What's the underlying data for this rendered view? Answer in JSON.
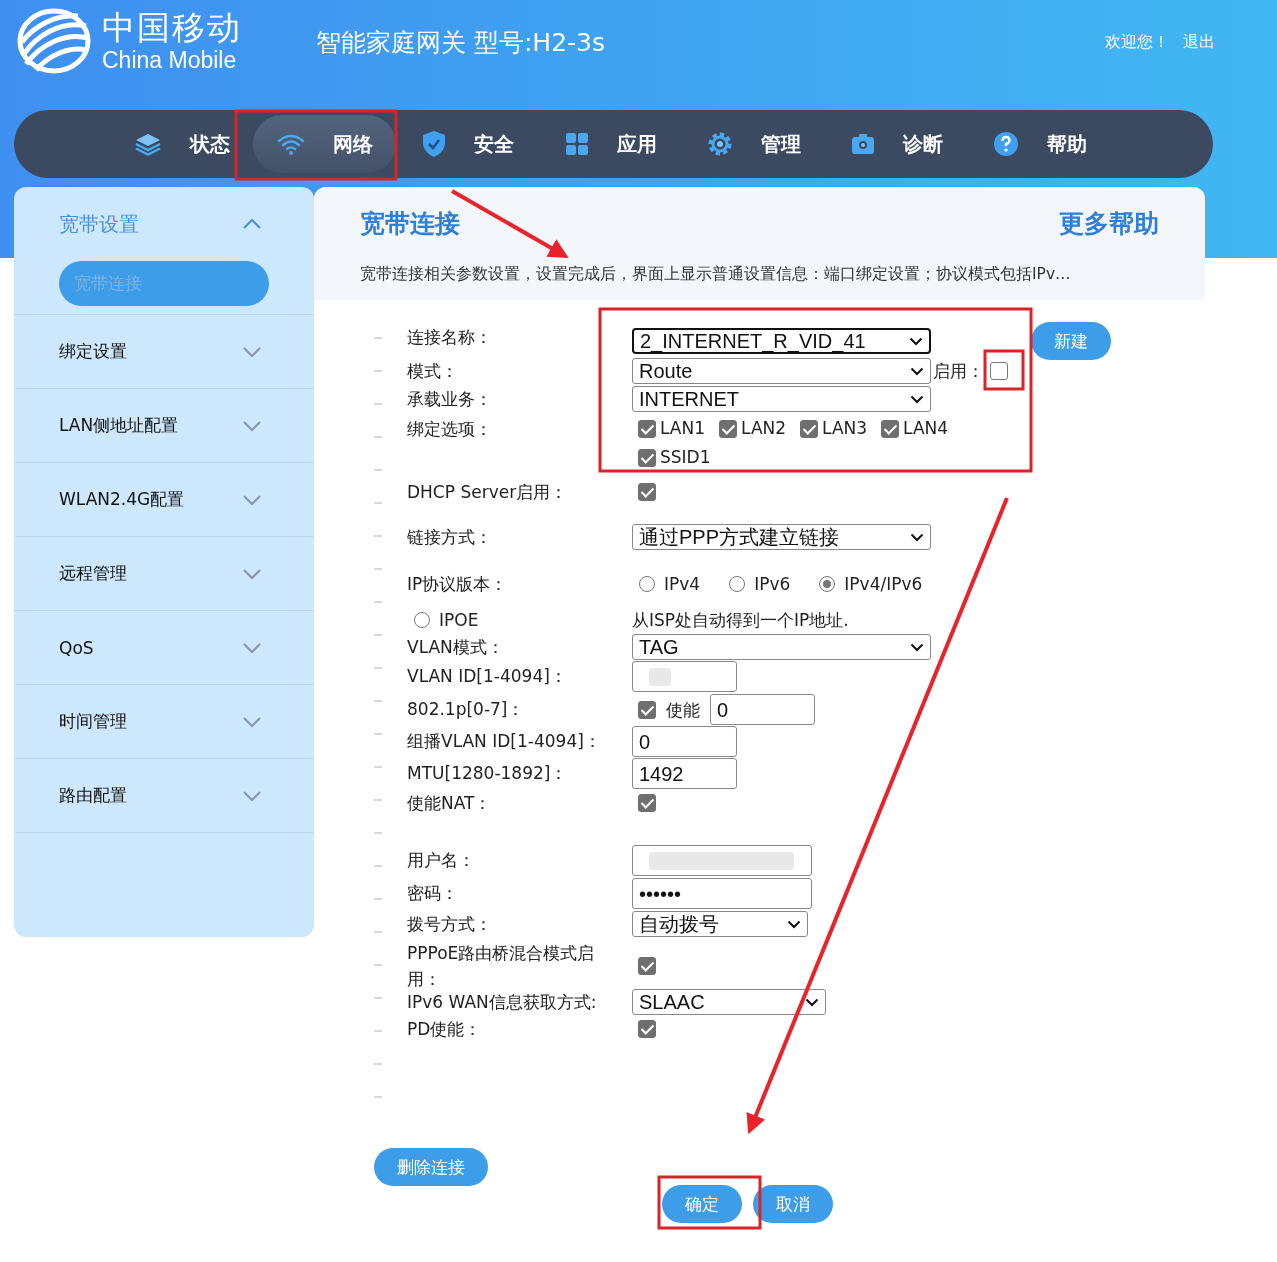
{
  "header": {
    "logo_cn": "中国移动",
    "logo_en": "China Mobile",
    "title": "智能家庭网关 型号:H2-3s",
    "welcome": "欢迎您！",
    "logout": "退出"
  },
  "nav": [
    {
      "label": "状态",
      "selected": false
    },
    {
      "label": "网络",
      "selected": true
    },
    {
      "label": "安全",
      "selected": false
    },
    {
      "label": "应用",
      "selected": false
    },
    {
      "label": "管理",
      "selected": false
    },
    {
      "label": "诊断",
      "selected": false
    },
    {
      "label": "帮助",
      "selected": false
    }
  ],
  "sidebar": [
    {
      "label": "宽带设置",
      "expanded": true,
      "children": [
        {
          "label": "宽带连接",
          "selected": true
        }
      ]
    },
    {
      "label": "绑定设置",
      "expanded": false
    },
    {
      "label": "LAN侧地址配置",
      "expanded": false
    },
    {
      "label": "WLAN2.4G配置",
      "expanded": false
    },
    {
      "label": "远程管理",
      "expanded": false
    },
    {
      "label": "QoS",
      "expanded": false
    },
    {
      "label": "时间管理",
      "expanded": false
    },
    {
      "label": "路由配置",
      "expanded": false
    }
  ],
  "main": {
    "title": "宽带连接",
    "help": "更多帮助",
    "description": "宽带连接相关参数设置，设置完成后，界面上显示普通设置信息：端口绑定设置；协议模式包括IPv…",
    "rows": [
      {
        "label": "连接名称：",
        "kind": "select",
        "value": "2_INTERNET_R_VID_41",
        "focused": true,
        "action": "新建"
      },
      {
        "label": "模式：",
        "kind": "select",
        "value": "Route",
        "toggle": {
          "label": "启用：",
          "checked": false
        }
      },
      {
        "label": "承载业务：",
        "kind": "select",
        "value": "INTERNET"
      },
      {
        "label": "绑定选项：",
        "kind": "checks",
        "options": [
          {
            "label": "LAN1",
            "checked": true
          },
          {
            "label": "LAN2",
            "checked": true
          },
          {
            "label": "LAN3",
            "checked": true
          },
          {
            "label": "LAN4",
            "checked": true
          },
          {
            "label": "SSID1",
            "checked": true
          }
        ]
      },
      {
        "label": "DHCP Server启用：",
        "kind": "checkbox",
        "checked": true
      },
      {
        "label": "链接方式：",
        "kind": "select",
        "value": "通过PPP方式建立链接"
      },
      {
        "label": "IP协议版本：",
        "kind": "radios",
        "options": [
          {
            "label": "IPv4",
            "selected": false
          },
          {
            "label": "IPv6",
            "selected": false
          },
          {
            "label": "IPv4/IPv6",
            "selected": true
          }
        ]
      },
      {
        "kind": "radio_note",
        "radio": {
          "label": "IPOE",
          "selected": false
        },
        "note": "从ISP处自动得到一个IP地址."
      },
      {
        "label": "VLAN模式：",
        "kind": "select",
        "value": "TAG"
      },
      {
        "label": "VLAN ID[1-4094]：",
        "kind": "redacted"
      },
      {
        "label": "802.1p[0-7]：",
        "kind": "check_text",
        "checked": true,
        "check_label": "使能",
        "value": "0"
      },
      {
        "label": "组播VLAN ID[1-4094]：",
        "kind": "text",
        "value": "0"
      },
      {
        "label": "MTU[1280-1892]：",
        "kind": "text",
        "value": "1492"
      },
      {
        "label": "使能NAT：",
        "kind": "checkbox",
        "checked": true
      },
      {
        "label": "用户名：",
        "kind": "redacted"
      },
      {
        "label": "密码：",
        "kind": "text",
        "value": "••••••"
      },
      {
        "label": "拨号方式：",
        "kind": "select",
        "value": "自动拨号"
      },
      {
        "label": "PPPoE路由桥混合模式启用：",
        "kind": "checkbox",
        "checked": true
      },
      {
        "label": "IPv6 WAN信息获取方式:",
        "kind": "select",
        "value": "SLAAC"
      },
      {
        "label": "PD使能：",
        "kind": "checkbox",
        "checked": true
      }
    ],
    "delete": "删除连接",
    "ok": "确定",
    "cancel": "取消"
  }
}
